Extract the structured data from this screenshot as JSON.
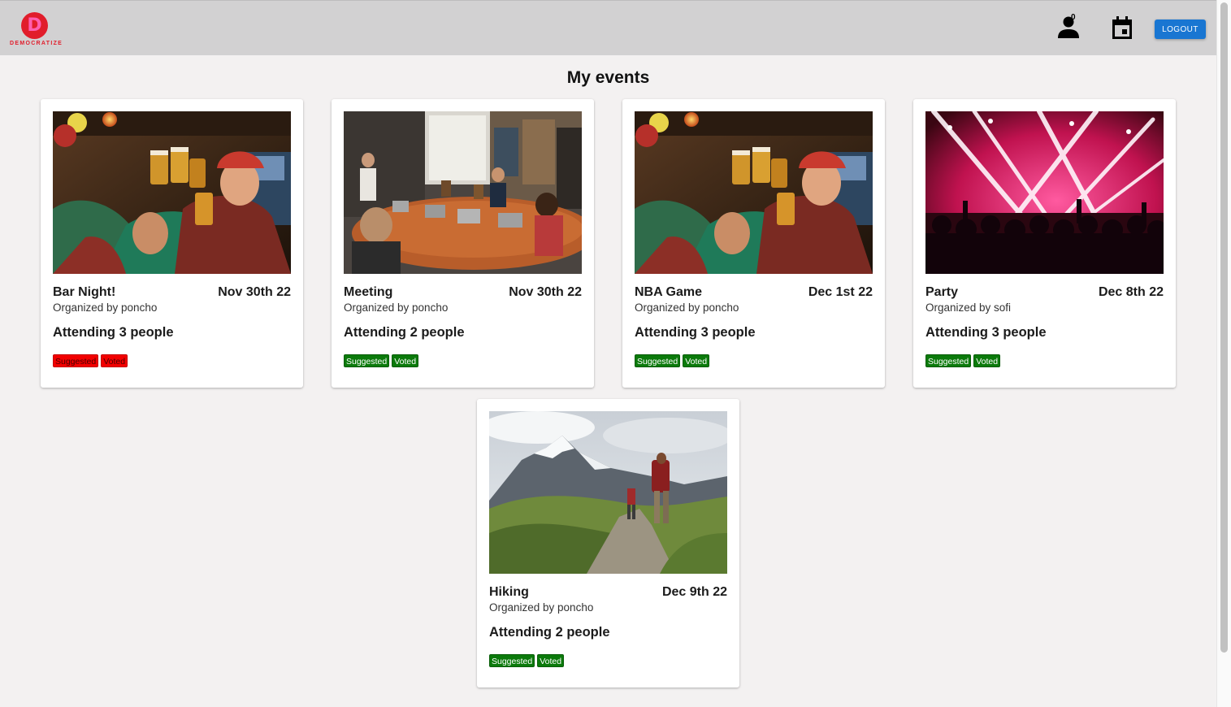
{
  "app": {
    "logo_text": "DEMOCRATIZE",
    "logo_letter": "D",
    "notification_count": "0",
    "logout_label": "LOGOUT",
    "colors": {
      "brand_red": "#e11d2b",
      "logout_blue": "#1976d2",
      "tag_green": "#0b7a0b",
      "tag_red": "#f20000"
    }
  },
  "page": {
    "title": "My events"
  },
  "events": [
    {
      "title": "Bar Night!",
      "date": "Nov 30th 22",
      "organizer": "Organized by poncho",
      "attending": "Attending 3 people",
      "image": "bar-photo",
      "tags": [
        "Suggested",
        "Voted"
      ],
      "tag_color": "red"
    },
    {
      "title": "Meeting",
      "date": "Nov 30th 22",
      "organizer": "Organized by poncho",
      "attending": "Attending 2 people",
      "image": "meeting-photo",
      "tags": [
        "Suggested",
        "Voted"
      ],
      "tag_color": "green"
    },
    {
      "title": "NBA Game",
      "date": "Dec 1st 22",
      "organizer": "Organized by poncho",
      "attending": "Attending 3 people",
      "image": "bar-photo",
      "tags": [
        "Suggested",
        "Voted"
      ],
      "tag_color": "green"
    },
    {
      "title": "Party",
      "date": "Dec 8th 22",
      "organizer": "Organized by sofi",
      "attending": "Attending 3 people",
      "image": "concert-photo",
      "tags": [
        "Suggested",
        "Voted"
      ],
      "tag_color": "green"
    },
    {
      "title": "Hiking",
      "date": "Dec 9th 22",
      "organizer": "Organized by poncho",
      "attending": "Attending 2 people",
      "image": "hiking-photo",
      "tags": [
        "Suggested",
        "Voted"
      ],
      "tag_color": "green"
    }
  ]
}
